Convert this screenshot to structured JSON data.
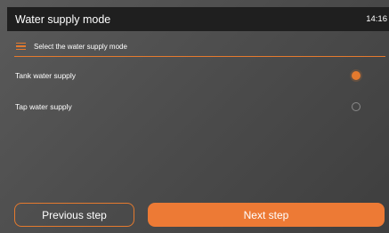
{
  "header": {
    "title": "Water supply mode",
    "time": "14:16"
  },
  "section": {
    "icon": "menu-icon",
    "label": "Select the water supply mode"
  },
  "options": [
    {
      "label": "Tank water supply",
      "selected": true
    },
    {
      "label": "Tap water supply",
      "selected": false
    }
  ],
  "footer": {
    "prev_label": "Previous step",
    "next_label": "Next step"
  },
  "colors": {
    "accent": "#e57a2e",
    "topbar": "#1f1f1f"
  }
}
